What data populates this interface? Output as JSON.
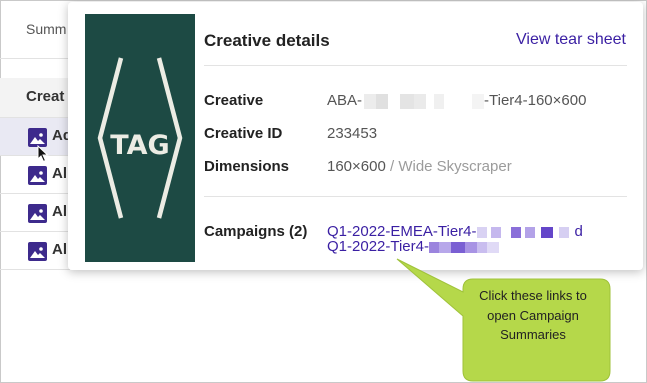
{
  "background": {
    "summary_label": "Summ",
    "column_header": "Creat",
    "rows": [
      "Ad",
      "Al",
      "Al",
      "Al"
    ]
  },
  "popover": {
    "title": "Creative details",
    "view_tear_sheet": "View tear sheet",
    "fields": {
      "creative_label": "Creative",
      "creative_prefix": "ABA-",
      "creative_suffix": "-Tier4-160×600",
      "creative_id_label": "Creative ID",
      "creative_id": "233453",
      "dimensions_label": "Dimensions",
      "dimensions_size": "160×600",
      "dimensions_name": "/ Wide Skyscraper",
      "campaigns_label": "Campaigns (2)"
    },
    "campaign_links": [
      "Q1-2022-EMEA-Tier4-",
      "Q1-2022-Tier4-"
    ],
    "campaign_link_tail": "d",
    "thumbnail_text": "TAG"
  },
  "callout": {
    "text": "Click these links to open Campaign Summaries",
    "color": "#b5d84a"
  },
  "colors": {
    "link": "#3a1fa3",
    "thumbnail_bg": "#1d4a44",
    "icon_bg": "#3d2a8c"
  }
}
